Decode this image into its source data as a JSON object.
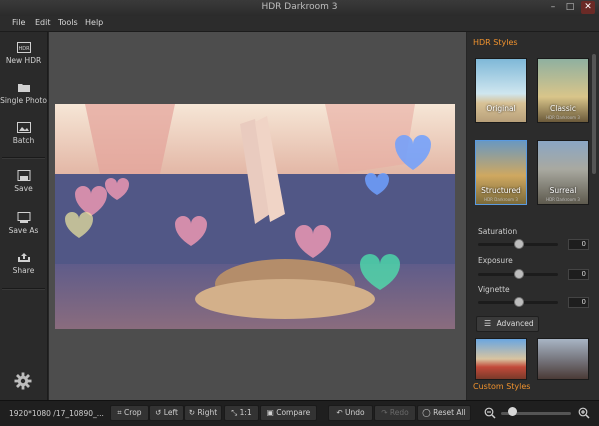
{
  "window": {
    "title": "HDR Darkroom 3",
    "min": "–",
    "max": "□",
    "close": "✕"
  },
  "menu": [
    "File",
    "Edit",
    "Tools",
    "Help"
  ],
  "sidebar": {
    "new_hdr": "New HDR",
    "single_photo": "Single Photo",
    "batch": "Batch",
    "save": "Save",
    "save_as": "Save As",
    "share": "Share"
  },
  "panel": {
    "styles_title": "HDR Styles",
    "styles": [
      {
        "label": "Original",
        "sub": ""
      },
      {
        "label": "Classic",
        "sub": "HDR Darkroom 3"
      },
      {
        "label": "Structured",
        "sub": "HDR Darkroom 3"
      },
      {
        "label": "Surreal",
        "sub": "HDR Darkroom 3"
      }
    ],
    "sliders": [
      {
        "label": "Saturation",
        "value": "0",
        "level": 0.5
      },
      {
        "label": "Exposure",
        "value": "0",
        "level": 0.5
      },
      {
        "label": "Vignette",
        "value": "0",
        "level": 0.5
      }
    ],
    "advanced": "Advanced",
    "custom_title": "Custom Styles"
  },
  "statusbar": {
    "info": "1920*1080 /17_10890_...",
    "crop": "Crop",
    "left": "Left",
    "right": "Right",
    "one_to_one": "1:1",
    "compare": "Compare",
    "undo": "Undo",
    "redo": "Redo",
    "reset_all": "Reset All",
    "zoom_level": 0.1
  },
  "colors": {
    "accent": "#f0922e",
    "selection": "#5a9ae0"
  }
}
